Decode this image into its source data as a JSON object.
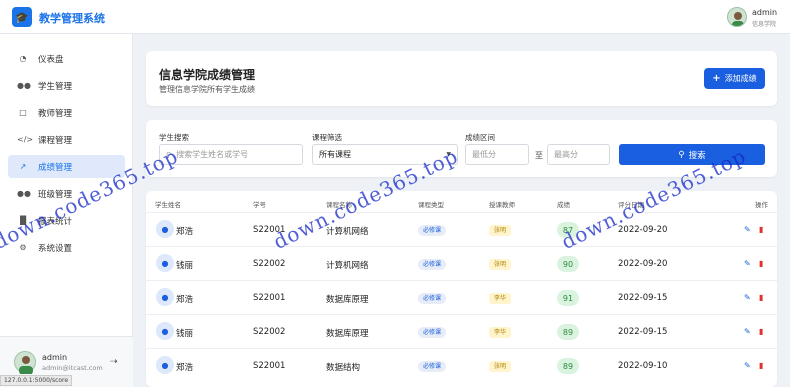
{
  "app": {
    "title": "教学管理系统",
    "logo_icon": "graduation-cap-icon"
  },
  "topbar": {
    "user_name": "admin",
    "user_dept": "信息学院"
  },
  "sidebar": {
    "items": [
      {
        "label": "仪表盘",
        "icon": "dashboard-icon",
        "active": false
      },
      {
        "label": "学生管理",
        "icon": "users-icon",
        "active": false
      },
      {
        "label": "教师管理",
        "icon": "teacher-icon",
        "active": false
      },
      {
        "label": "课程管理",
        "icon": "code-icon",
        "active": false
      },
      {
        "label": "成绩管理",
        "icon": "chart-line-icon",
        "active": true
      },
      {
        "label": "班级管理",
        "icon": "group-icon",
        "active": false
      },
      {
        "label": "报表统计",
        "icon": "bar-chart-icon",
        "active": false
      },
      {
        "label": "系统设置",
        "icon": "gear-icon",
        "active": false
      }
    ],
    "footer": {
      "name": "admin",
      "email": "admin@itcast.com"
    }
  },
  "status_url": "127.0.0.1:5000/score",
  "header": {
    "title": "信息学院成绩管理",
    "subtitle": "管理信息学院所有学生成绩",
    "add_button": "添加成绩"
  },
  "filters": {
    "search_label": "学生搜索",
    "search_placeholder": "搜索学生姓名或学号",
    "course_label": "课程筛选",
    "course_value": "所有课程",
    "range_label": "成绩区间",
    "min_placeholder": "最低分",
    "range_sep": "至",
    "max_placeholder": "最高分",
    "search_button": "搜索"
  },
  "table": {
    "headers": [
      "学生姓名",
      "学号",
      "课程名称",
      "课程类型",
      "授课教师",
      "成绩",
      "评分日期",
      "操作"
    ],
    "rows": [
      {
        "name": "郑浩",
        "id": "S22001",
        "course": "计算机网络",
        "type": "必修课",
        "teacher": "张明",
        "score": "87",
        "date": "2022-09-20"
      },
      {
        "name": "钱丽",
        "id": "S22002",
        "course": "计算机网络",
        "type": "必修课",
        "teacher": "张明",
        "score": "90",
        "date": "2022-09-20"
      },
      {
        "name": "郑浩",
        "id": "S22001",
        "course": "数据库原理",
        "type": "必修课",
        "teacher": "李华",
        "score": "91",
        "date": "2022-09-15"
      },
      {
        "name": "钱丽",
        "id": "S22002",
        "course": "数据库原理",
        "type": "必修课",
        "teacher": "李华",
        "score": "89",
        "date": "2022-09-15"
      },
      {
        "name": "郑浩",
        "id": "S22001",
        "course": "数据结构",
        "type": "必修课",
        "teacher": "张明",
        "score": "89",
        "date": "2022-09-10"
      }
    ]
  },
  "watermark": {
    "text": "down.code365.top"
  },
  "colors": {
    "primary": "#1a5fe0",
    "accent": "#1a73e8",
    "active_bg": "#dfe9fb",
    "danger": "#e03131",
    "score_bg": "#daf3df"
  }
}
